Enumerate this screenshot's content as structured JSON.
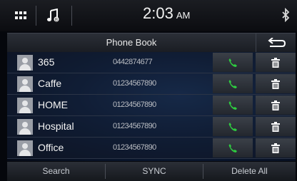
{
  "status_bar": {
    "time": "2:03",
    "ampm": "AM"
  },
  "header": {
    "title": "Phone Book"
  },
  "contacts": [
    {
      "name": "365",
      "number": "0442874677"
    },
    {
      "name": "Caffe",
      "number": "01234567890"
    },
    {
      "name": "HOME",
      "number": "01234567890"
    },
    {
      "name": "Hospital",
      "number": "01234567890"
    },
    {
      "name": "Office",
      "number": "01234567890"
    }
  ],
  "bottom_bar": {
    "search_label": "Search",
    "sync_label": "SYNC",
    "delete_all_label": "Delete All"
  },
  "colors": {
    "call_icon": "#2ecc40",
    "background": "#05070c"
  },
  "icons": {
    "menu": "grid-icon",
    "music": "music-note-icon",
    "bluetooth": "bluetooth-icon",
    "back": "back-arrow-icon",
    "call": "phone-icon",
    "delete": "trash-icon",
    "avatar": "person-icon"
  }
}
